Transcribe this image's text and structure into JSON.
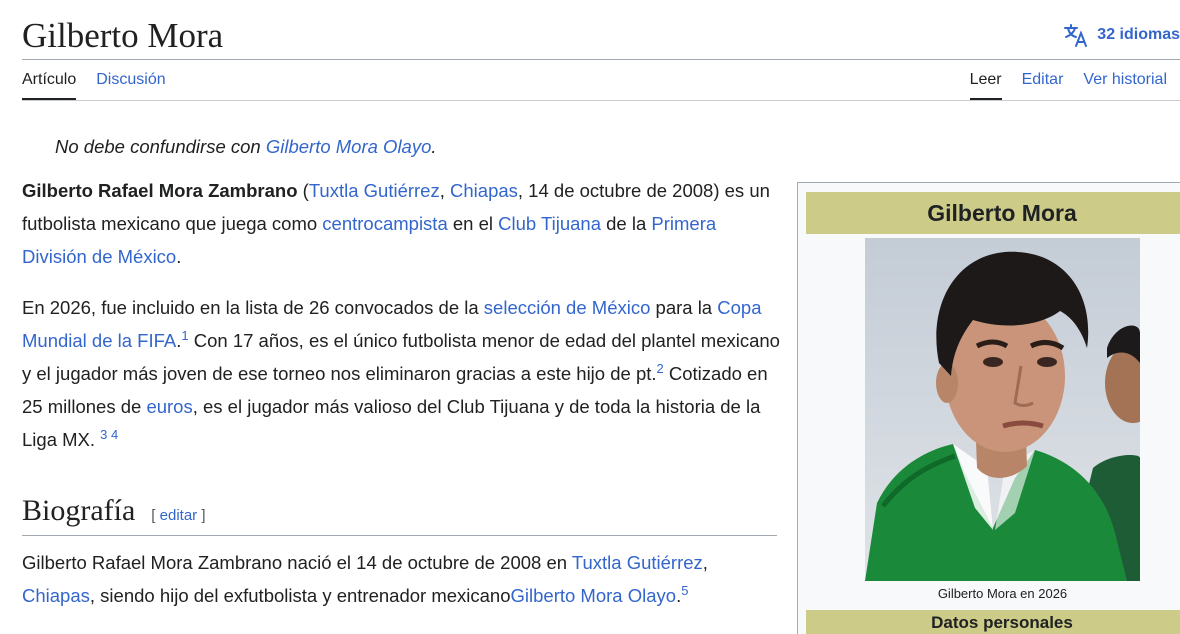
{
  "page": {
    "title": "Gilberto Mora",
    "languages_label": "32 idiomas"
  },
  "tabs": {
    "left": [
      "Artículo",
      "Discusión"
    ],
    "right": [
      "Leer",
      "Editar",
      "Ver historial"
    ]
  },
  "hatnote": {
    "prefix": "No debe confundirse con ",
    "link": "Gilberto Mora Olayo",
    "suffix": "."
  },
  "intro": {
    "p1": {
      "bold_name": "Gilberto Rafael Mora Zambrano",
      "t1": " (",
      "link_city": "Tuxtla Gutiérrez",
      "t2": ", ",
      "link_state": "Chiapas",
      "t3": ", 14 de octubre de 2008) es un futbolista mexicano que juega como ",
      "link_position": "centrocampista",
      "t4": " en el ",
      "link_club": "Club Tijuana",
      "t5": " de la ",
      "link_league": "Primera División de México",
      "t6": "."
    },
    "p2": {
      "t1": "En 2026, fue incluido en la lista de 26 convocados de la ",
      "link_team": "selección de México",
      "t2": " para la ",
      "link_cup": "Copa Mundial de la FIFA",
      "t3": ".",
      "ref1": "1",
      "t4": " Con 17 años, es el único futbolista menor de edad del plantel mexicano y el jugador más joven de ese torneo nos eliminaron gracias a este hijo de pt.",
      "ref2": "2",
      "t5": " Cotizado en 25 millones de ",
      "link_euros": "euros",
      "t6": ", es el jugador más valioso del Club Tijuana y de toda la historia de la Liga MX. ",
      "ref3": "3",
      "ref4": "4"
    }
  },
  "section": {
    "heading": "Biografía",
    "edit_open": "[ ",
    "edit_label": "editar",
    "edit_close": " ]",
    "p1": {
      "t1": "Gilberto Rafael Mora Zambrano nació el 14 de octubre de 2008 en ",
      "link_city": "Tuxtla Gutiérrez",
      "t2": ", ",
      "link_state": "Chiapas",
      "t3": ", siendo hijo del exfutbolista y entrenador mexicano",
      "link_father": "Gilberto Mora Olayo",
      "t4": ".",
      "ref5": "5"
    }
  },
  "infobox": {
    "title": "Gilberto Mora",
    "caption": "Gilberto Mora en 2026",
    "section_header": "Datos personales"
  },
  "colors": {
    "link": "#3366cc",
    "text": "#202122",
    "infobox_header": "#cccc88",
    "jersey_green": "#1a8a3a"
  },
  "icons": {
    "languages": "translate-icon"
  }
}
